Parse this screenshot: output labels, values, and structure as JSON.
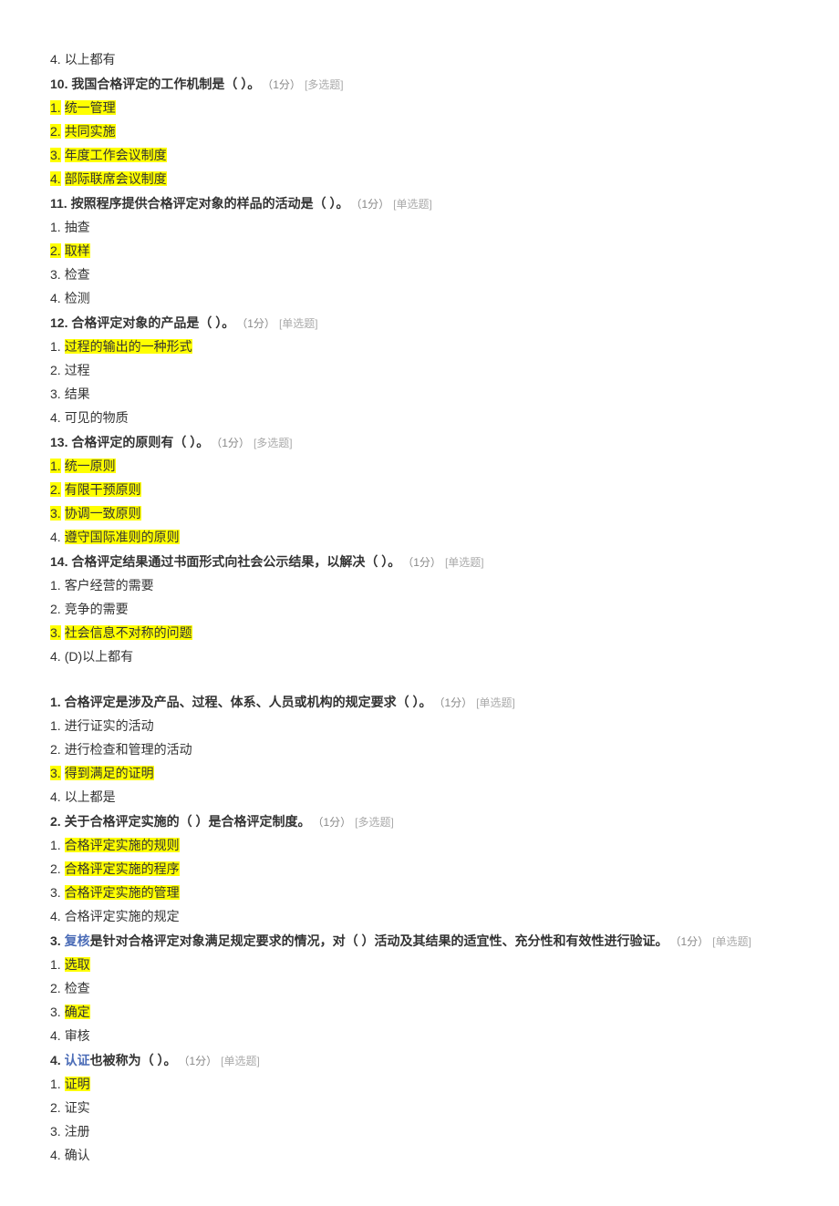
{
  "items": [
    {
      "type": "option",
      "num": "4.",
      "text": "以上都有",
      "hl": false
    },
    {
      "type": "question",
      "num": "10.",
      "text": "我国合格评定的工作机制是（ ）。",
      "pts": "（1分）",
      "tag": "[多选题]"
    },
    {
      "type": "option",
      "num": "1.",
      "text": "统一管理",
      "hl": true,
      "hlNum": true
    },
    {
      "type": "option",
      "num": "2.",
      "text": "共同实施",
      "hl": true,
      "hlNum": true
    },
    {
      "type": "option",
      "num": "3.",
      "text": "年度工作会议制度",
      "hl": true,
      "hlNum": true
    },
    {
      "type": "option",
      "num": "4.",
      "text": "部际联席会议制度",
      "hl": true,
      "hlNum": true
    },
    {
      "type": "question",
      "num": "11.",
      "text": "按照程序提供合格评定对象的样品的活动是（ ）。",
      "pts": "（1分）",
      "tag": "[单选题]"
    },
    {
      "type": "option",
      "num": "1.",
      "text": "抽查",
      "hl": false
    },
    {
      "type": "option",
      "num": "2.",
      "text": "取样",
      "hl": true,
      "hlNum": true
    },
    {
      "type": "option",
      "num": "3.",
      "text": "检查",
      "hl": false
    },
    {
      "type": "option",
      "num": "4.",
      "text": "检测",
      "hl": false
    },
    {
      "type": "question",
      "num": "12.",
      "text": "合格评定对象的产品是（ ）。",
      "pts": "（1分）",
      "tag": "[单选题]"
    },
    {
      "type": "option",
      "num": "1.",
      "text": "过程的输出的一种形式",
      "hl": true,
      "hlNum": false
    },
    {
      "type": "option",
      "num": "2.",
      "text": "过程",
      "hl": false
    },
    {
      "type": "option",
      "num": "3.",
      "text": "结果",
      "hl": false
    },
    {
      "type": "option",
      "num": "4.",
      "text": "可见的物质",
      "hl": false
    },
    {
      "type": "question",
      "num": "13.",
      "text": "合格评定的原则有（ ）。",
      "pts": "（1分）",
      "tag": "[多选题]"
    },
    {
      "type": "option",
      "num": "1.",
      "text": "统一原则",
      "hl": true,
      "hlNum": true
    },
    {
      "type": "option",
      "num": "2.",
      "text": "有限干预原则",
      "hl": true,
      "hlNum": true
    },
    {
      "type": "option",
      "num": "3.",
      "text": "协调一致原则",
      "hl": true,
      "hlNum": true
    },
    {
      "type": "option",
      "num": "4.",
      "text": "遵守国际准则的原则",
      "hl": true,
      "hlNum": false
    },
    {
      "type": "question",
      "num": "14.",
      "text": "合格评定结果通过书面形式向社会公示结果，以解决（ ）。",
      "pts": "（1分）",
      "tag": "[单选题]"
    },
    {
      "type": "option",
      "num": "1.",
      "text": "客户经营的需要",
      "hl": false
    },
    {
      "type": "option",
      "num": "2.",
      "text": "竞争的需要",
      "hl": false
    },
    {
      "type": "option",
      "num": "3.",
      "text": "社会信息不对称的问题",
      "hl": true,
      "hlNum": true
    },
    {
      "type": "option",
      "num": "4.",
      "text": "(D)以上都有",
      "hl": false
    },
    {
      "type": "gap"
    },
    {
      "type": "question",
      "num": "1.",
      "text": "合格评定是涉及产品、过程、体系、人员或机构的规定要求（ ）。",
      "pts": "（1分）",
      "tag": "[单选题]"
    },
    {
      "type": "option",
      "num": "1.",
      "text": "进行证实的活动",
      "hl": false
    },
    {
      "type": "option",
      "num": "2.",
      "text": "进行检查和管理的活动",
      "hl": false
    },
    {
      "type": "option",
      "num": "3.",
      "text": "得到满足的证明",
      "hl": true,
      "hlNum": true
    },
    {
      "type": "option",
      "num": "4.",
      "text": "以上都是",
      "hl": false
    },
    {
      "type": "question",
      "num": "2.",
      "text": "关于合格评定实施的（ ）是合格评定制度。",
      "pts": "（1分）",
      "tag": "[多选题]"
    },
    {
      "type": "option",
      "num": "1.",
      "text": "合格评定实施的规则",
      "hl": true,
      "hlNum": false
    },
    {
      "type": "option",
      "num": "2.",
      "text": "合格评定实施的程序",
      "hl": true,
      "hlNum": false
    },
    {
      "type": "option",
      "num": "3.",
      "text": "合格评定实施的管理",
      "hl": true,
      "hlNum": false
    },
    {
      "type": "option",
      "num": "4.",
      "text": "合格评定实施的规定",
      "hl": false
    },
    {
      "type": "question_link",
      "num": "3.",
      "link": "复核",
      "text": "是针对合格评定对象满足规定要求的情况，对（ ）活动及其结果的适宜性、充分性和有效性进行验证。",
      "pts": "（1分）",
      "tag": "[单选题]",
      "wrap": true
    },
    {
      "type": "option",
      "num": "1.",
      "text": "选取",
      "hl": true,
      "hlNum": false
    },
    {
      "type": "option",
      "num": "2.",
      "text": "检查",
      "hl": false
    },
    {
      "type": "option",
      "num": "3.",
      "text": "确定",
      "hl": true,
      "hlNum": false
    },
    {
      "type": "option",
      "num": "4.",
      "text": "审核",
      "hl": false
    },
    {
      "type": "question_link",
      "num": "4.",
      "link": "认证",
      "text": "也被称为（ ）。",
      "pts": "（1分）",
      "tag": "[单选题]"
    },
    {
      "type": "option",
      "num": "1.",
      "text": "证明",
      "hl": true,
      "hlNum": false
    },
    {
      "type": "option",
      "num": "2.",
      "text": "证实",
      "hl": false
    },
    {
      "type": "option",
      "num": "3.",
      "text": "注册",
      "hl": false
    },
    {
      "type": "option",
      "num": "4.",
      "text": "确认",
      "hl": false
    }
  ]
}
